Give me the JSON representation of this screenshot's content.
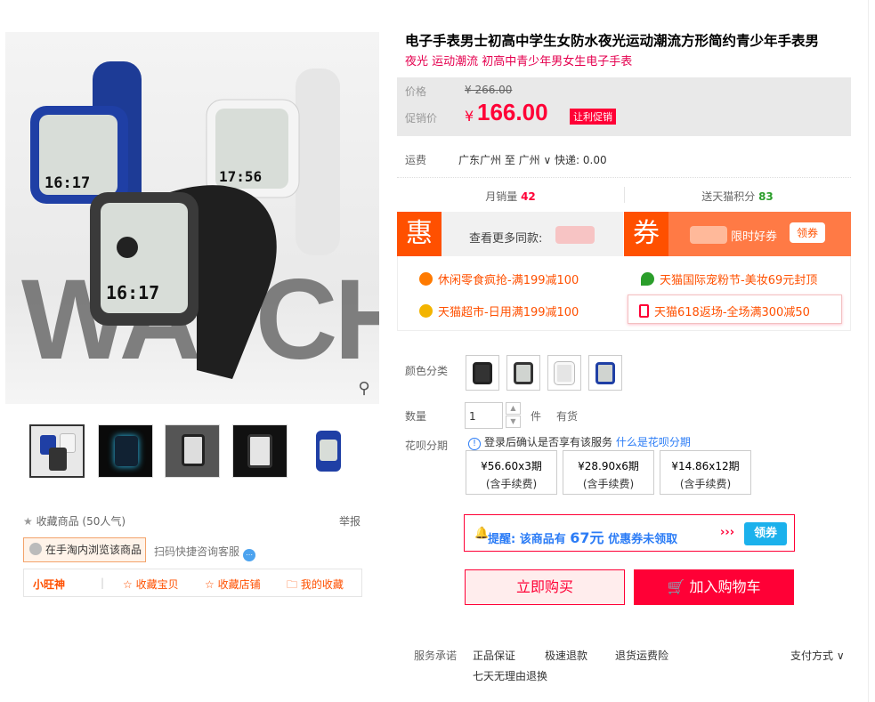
{
  "product": {
    "title": "电子手表男士初高中学生女防水夜光运动潮流方形简约青少年手表男",
    "subtitle": "夜光 运动潮流 初高中青少年男女生电子手表",
    "image_word": "WATCH",
    "zoom_icon": "magnifier-icon"
  },
  "price": {
    "label": "价格",
    "original": "¥ 266.00",
    "promo_label": "促销价",
    "currency": "¥",
    "current": "166.00",
    "tag": "让利促销"
  },
  "shipping": {
    "label": "运费",
    "value": "广东广州  至  广州 ∨  快递: 0.00"
  },
  "stats": {
    "sales_label": "月销量",
    "sales_value": "42",
    "points_label": "送天猫积分",
    "points_value": "83"
  },
  "coupons": {
    "hui_char": "惠",
    "hui_text": "查看更多同款:",
    "quan_char": "券",
    "quan_text": "限时好券",
    "quan_button": "领券"
  },
  "promotions": [
    {
      "text": "休闲零食疯抢-满199减100",
      "icon": "sun-icon",
      "color": "#ff7a00"
    },
    {
      "text": "天猫国际宠粉节-美妆69元封顶",
      "icon": "leaf-icon",
      "color": "#2b9e2b"
    },
    {
      "text": "天猫超市-日用满199减100",
      "icon": "flower-icon",
      "color": "#f3b400"
    },
    {
      "text": "天猫618返场-全场满300减50",
      "icon": "phone-icon",
      "color": "#ff0036"
    }
  ],
  "options": {
    "color_label": "颜色分类",
    "qty_label": "数量",
    "qty_value": "1",
    "qty_unit": "件",
    "stock": "有货",
    "huabei_label": "花呗分期",
    "huabei_note": "登录后确认是否享有该服务",
    "huabei_link": "什么是花呗分期",
    "plans": [
      {
        "amount": "¥56.60x3期",
        "fee": "(含手续费)"
      },
      {
        "amount": "¥28.90x6期",
        "fee": "(含手续费)"
      },
      {
        "amount": "¥14.86x12期",
        "fee": "(含手续费)"
      }
    ]
  },
  "reminder": {
    "prefix": "提醒: 该商品有",
    "amount": "67元",
    "suffix": "优惠券未领取",
    "arrows": "›››",
    "button": "领券"
  },
  "actions": {
    "buy": "立即购买",
    "cart": "加入购物车"
  },
  "service": {
    "label": "服务承诺",
    "items": [
      "正品保证",
      "极速退款",
      "退货运费险",
      "七天无理由退换"
    ],
    "payment": "支付方式 ∨"
  },
  "left": {
    "fav": "收藏商品  (50人气)",
    "report": "举报",
    "taobao": "在手淘内浏览该商品",
    "scan": "扫码快捷咨询客服",
    "wangwang": "小旺神",
    "links": [
      "☆ 收藏宝贝",
      "☆ 收藏店铺",
      "🗀 我的收藏"
    ]
  }
}
